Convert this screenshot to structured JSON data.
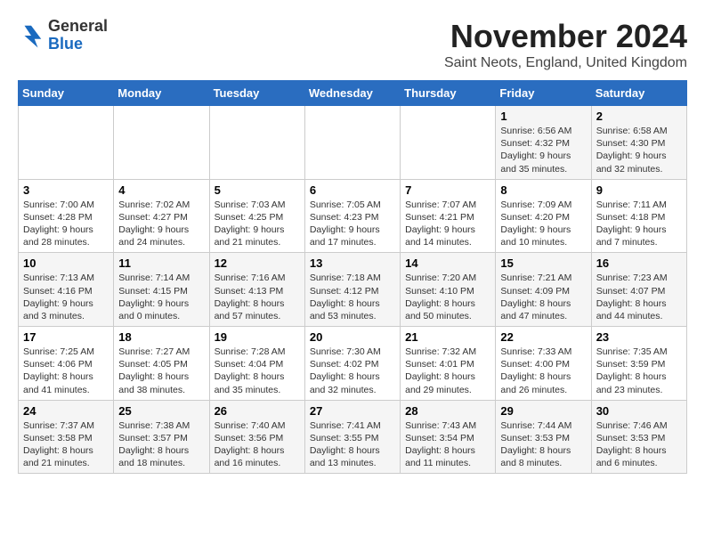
{
  "header": {
    "logo_general": "General",
    "logo_blue": "Blue",
    "month_title": "November 2024",
    "location": "Saint Neots, England, United Kingdom"
  },
  "days_of_week": [
    "Sunday",
    "Monday",
    "Tuesday",
    "Wednesday",
    "Thursday",
    "Friday",
    "Saturday"
  ],
  "weeks": [
    [
      {
        "day": "",
        "info": ""
      },
      {
        "day": "",
        "info": ""
      },
      {
        "day": "",
        "info": ""
      },
      {
        "day": "",
        "info": ""
      },
      {
        "day": "",
        "info": ""
      },
      {
        "day": "1",
        "info": "Sunrise: 6:56 AM\nSunset: 4:32 PM\nDaylight: 9 hours and 35 minutes."
      },
      {
        "day": "2",
        "info": "Sunrise: 6:58 AM\nSunset: 4:30 PM\nDaylight: 9 hours and 32 minutes."
      }
    ],
    [
      {
        "day": "3",
        "info": "Sunrise: 7:00 AM\nSunset: 4:28 PM\nDaylight: 9 hours and 28 minutes."
      },
      {
        "day": "4",
        "info": "Sunrise: 7:02 AM\nSunset: 4:27 PM\nDaylight: 9 hours and 24 minutes."
      },
      {
        "day": "5",
        "info": "Sunrise: 7:03 AM\nSunset: 4:25 PM\nDaylight: 9 hours and 21 minutes."
      },
      {
        "day": "6",
        "info": "Sunrise: 7:05 AM\nSunset: 4:23 PM\nDaylight: 9 hours and 17 minutes."
      },
      {
        "day": "7",
        "info": "Sunrise: 7:07 AM\nSunset: 4:21 PM\nDaylight: 9 hours and 14 minutes."
      },
      {
        "day": "8",
        "info": "Sunrise: 7:09 AM\nSunset: 4:20 PM\nDaylight: 9 hours and 10 minutes."
      },
      {
        "day": "9",
        "info": "Sunrise: 7:11 AM\nSunset: 4:18 PM\nDaylight: 9 hours and 7 minutes."
      }
    ],
    [
      {
        "day": "10",
        "info": "Sunrise: 7:13 AM\nSunset: 4:16 PM\nDaylight: 9 hours and 3 minutes."
      },
      {
        "day": "11",
        "info": "Sunrise: 7:14 AM\nSunset: 4:15 PM\nDaylight: 9 hours and 0 minutes."
      },
      {
        "day": "12",
        "info": "Sunrise: 7:16 AM\nSunset: 4:13 PM\nDaylight: 8 hours and 57 minutes."
      },
      {
        "day": "13",
        "info": "Sunrise: 7:18 AM\nSunset: 4:12 PM\nDaylight: 8 hours and 53 minutes."
      },
      {
        "day": "14",
        "info": "Sunrise: 7:20 AM\nSunset: 4:10 PM\nDaylight: 8 hours and 50 minutes."
      },
      {
        "day": "15",
        "info": "Sunrise: 7:21 AM\nSunset: 4:09 PM\nDaylight: 8 hours and 47 minutes."
      },
      {
        "day": "16",
        "info": "Sunrise: 7:23 AM\nSunset: 4:07 PM\nDaylight: 8 hours and 44 minutes."
      }
    ],
    [
      {
        "day": "17",
        "info": "Sunrise: 7:25 AM\nSunset: 4:06 PM\nDaylight: 8 hours and 41 minutes."
      },
      {
        "day": "18",
        "info": "Sunrise: 7:27 AM\nSunset: 4:05 PM\nDaylight: 8 hours and 38 minutes."
      },
      {
        "day": "19",
        "info": "Sunrise: 7:28 AM\nSunset: 4:04 PM\nDaylight: 8 hours and 35 minutes."
      },
      {
        "day": "20",
        "info": "Sunrise: 7:30 AM\nSunset: 4:02 PM\nDaylight: 8 hours and 32 minutes."
      },
      {
        "day": "21",
        "info": "Sunrise: 7:32 AM\nSunset: 4:01 PM\nDaylight: 8 hours and 29 minutes."
      },
      {
        "day": "22",
        "info": "Sunrise: 7:33 AM\nSunset: 4:00 PM\nDaylight: 8 hours and 26 minutes."
      },
      {
        "day": "23",
        "info": "Sunrise: 7:35 AM\nSunset: 3:59 PM\nDaylight: 8 hours and 23 minutes."
      }
    ],
    [
      {
        "day": "24",
        "info": "Sunrise: 7:37 AM\nSunset: 3:58 PM\nDaylight: 8 hours and 21 minutes."
      },
      {
        "day": "25",
        "info": "Sunrise: 7:38 AM\nSunset: 3:57 PM\nDaylight: 8 hours and 18 minutes."
      },
      {
        "day": "26",
        "info": "Sunrise: 7:40 AM\nSunset: 3:56 PM\nDaylight: 8 hours and 16 minutes."
      },
      {
        "day": "27",
        "info": "Sunrise: 7:41 AM\nSunset: 3:55 PM\nDaylight: 8 hours and 13 minutes."
      },
      {
        "day": "28",
        "info": "Sunrise: 7:43 AM\nSunset: 3:54 PM\nDaylight: 8 hours and 11 minutes."
      },
      {
        "day": "29",
        "info": "Sunrise: 7:44 AM\nSunset: 3:53 PM\nDaylight: 8 hours and 8 minutes."
      },
      {
        "day": "30",
        "info": "Sunrise: 7:46 AM\nSunset: 3:53 PM\nDaylight: 8 hours and 6 minutes."
      }
    ]
  ]
}
